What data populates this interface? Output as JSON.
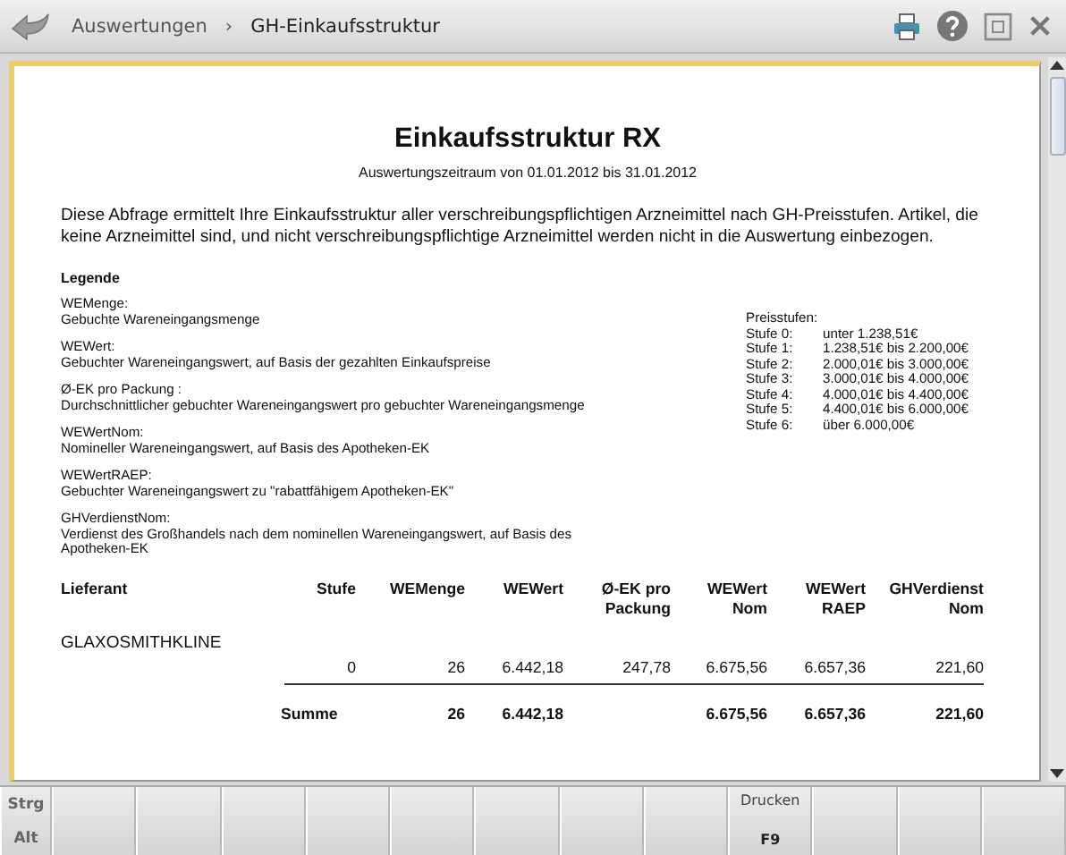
{
  "header": {
    "breadcrumb": [
      "Auswertungen",
      "GH-Einkaufsstruktur"
    ],
    "separator": "›"
  },
  "report": {
    "title": "Einkaufsstruktur RX",
    "subtitle": "Auswertungszeitraum von 01.01.2012 bis 31.01.2012",
    "intro": "Diese Abfrage ermittelt Ihre Einkaufsstruktur aller verschreibungspflichtigen Arzneimittel nach GH-Preisstufen. Artikel, die keine Arzneimittel sind, und nicht verschreibungspflichtige Arzneimittel werden nicht in die Auswertung einbezogen.",
    "legend_title": "Legende",
    "legend": [
      {
        "term": "WEMenge:",
        "definition": "Gebuchte Wareneingangsmenge"
      },
      {
        "term": "WEWert:",
        "definition": "Gebuchter Wareneingangswert, auf Basis der gezahlten Einkaufspreise"
      },
      {
        "term": "Ø-EK pro Packung :",
        "definition": "Durchschnittlicher gebuchter Wareneingangswert pro gebuchter Wareneingangsmenge"
      },
      {
        "term": "WEWertNom:",
        "definition": "Nomineller Wareneingangswert, auf Basis des Apotheken-EK"
      },
      {
        "term": "WEWertRAEP:",
        "definition": "Gebuchter Wareneingangswert zu \"rabattfähigem Apotheken-EK\""
      },
      {
        "term": "GHVerdienstNom:",
        "definition": "Verdienst des Großhandels nach dem nominellen Wareneingangswert, auf Basis des Apotheken-EK"
      }
    ],
    "price_levels_title": "Preisstufen:",
    "price_levels": [
      {
        "level": "Stufe 0:",
        "range": "unter 1.238,51€"
      },
      {
        "level": "Stufe 1:",
        "range": "1.238,51€ bis 2.200,00€"
      },
      {
        "level": "Stufe 2:",
        "range": "2.000,01€ bis 3.000,00€"
      },
      {
        "level": "Stufe 3:",
        "range": "3.000,01€ bis 4.000,00€"
      },
      {
        "level": "Stufe 4:",
        "range": "4.000,01€ bis 4.400,00€"
      },
      {
        "level": "Stufe 5:",
        "range": "4.400,01€ bis 6.000,00€"
      },
      {
        "level": "Stufe 6:",
        "range": "über 6.000,00€"
      }
    ],
    "table": {
      "columns": [
        [
          "Lieferant"
        ],
        [
          "Stufe"
        ],
        [
          "WEMenge"
        ],
        [
          "WEWert"
        ],
        [
          "Ø-EK pro",
          "Packung"
        ],
        [
          "WEWert",
          "Nom"
        ],
        [
          "WEWert",
          "RAEP"
        ],
        [
          "GHVerdienst",
          "Nom"
        ]
      ],
      "groups": [
        {
          "supplier": "GLAXOSMITHKLINE",
          "rows": [
            [
              "0",
              "26",
              "6.442,18",
              "247,78",
              "6.675,56",
              "6.657,36",
              "221,60"
            ]
          ],
          "total": {
            "label": "Summe",
            "cells": [
              {
                "kind": "value",
                "value": "26"
              },
              {
                "kind": "value",
                "value": "6.442,18"
              },
              {
                "kind": "blank"
              },
              {
                "kind": "value",
                "value": "6.675,56"
              },
              {
                "kind": "value",
                "value": "6.657,36"
              },
              {
                "kind": "value",
                "value": "221,60"
              }
            ]
          }
        }
      ]
    }
  },
  "function_keys": {
    "modifiers": [
      "Strg",
      "Alt"
    ],
    "keys": [
      {
        "kind": "empty"
      },
      {
        "kind": "empty"
      },
      {
        "kind": "empty"
      },
      {
        "kind": "empty"
      },
      {
        "kind": "empty"
      },
      {
        "kind": "empty"
      },
      {
        "kind": "empty"
      },
      {
        "kind": "empty"
      },
      {
        "kind": "command",
        "label": "Drucken",
        "key": "F9"
      },
      {
        "kind": "empty"
      },
      {
        "kind": "empty"
      },
      {
        "kind": "empty"
      }
    ]
  }
}
